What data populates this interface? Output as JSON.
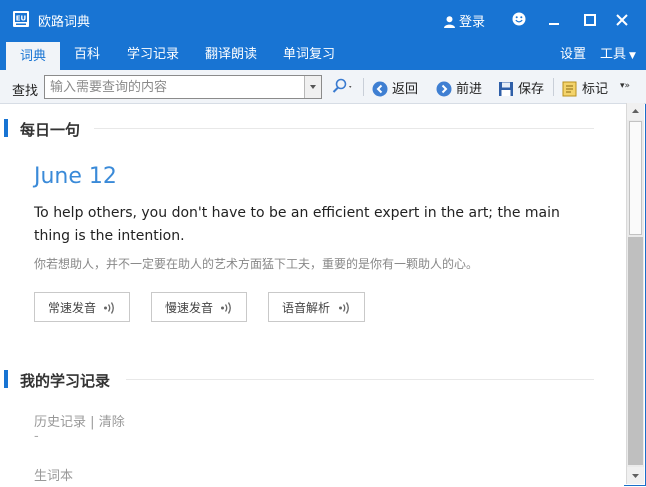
{
  "window": {
    "title": "欧路词典",
    "login_label": "登录"
  },
  "tabs": [
    {
      "label": "词典",
      "active": true
    },
    {
      "label": "百科",
      "active": false
    },
    {
      "label": "学习记录",
      "active": false
    },
    {
      "label": "翻译朗读",
      "active": false
    },
    {
      "label": "单词复习",
      "active": false
    }
  ],
  "tabs_right": {
    "settings_label": "设置",
    "tools_label": "工具"
  },
  "toolbar": {
    "find_label": "查找",
    "search_placeholder": "输入需要查询的内容",
    "search_value": "",
    "back_label": "返回",
    "forward_label": "前进",
    "save_label": "保存",
    "mark_label": "标记"
  },
  "daily": {
    "section_title": "每日一句",
    "date": "June 12",
    "english": "To help others, you don't have to be an efficient expert in the art; the main thing is the intention.",
    "chinese": "你若想助人，并不一定要在助人的艺术方面猛下工夫，重要的是你有一颗助人的心。",
    "buttons": [
      {
        "label": "常速发音"
      },
      {
        "label": "慢速发音"
      },
      {
        "label": "语音解析"
      }
    ]
  },
  "learning": {
    "section_title": "我的学习记录",
    "history_label": "历史记录",
    "separator": "|",
    "clear_label": "清除",
    "history_empty": "-",
    "vocab_label": "生词本"
  },
  "colors": {
    "accent": "#1874d3",
    "date_blue": "#3a8ad8"
  },
  "icons": [
    "app-logo-icon",
    "user-icon",
    "smile-icon",
    "minimize-icon",
    "maximize-icon",
    "close-icon",
    "magnifier-icon",
    "back-icon",
    "forward-icon",
    "save-icon",
    "mark-icon",
    "overflow-icon",
    "speaker-icon"
  ]
}
